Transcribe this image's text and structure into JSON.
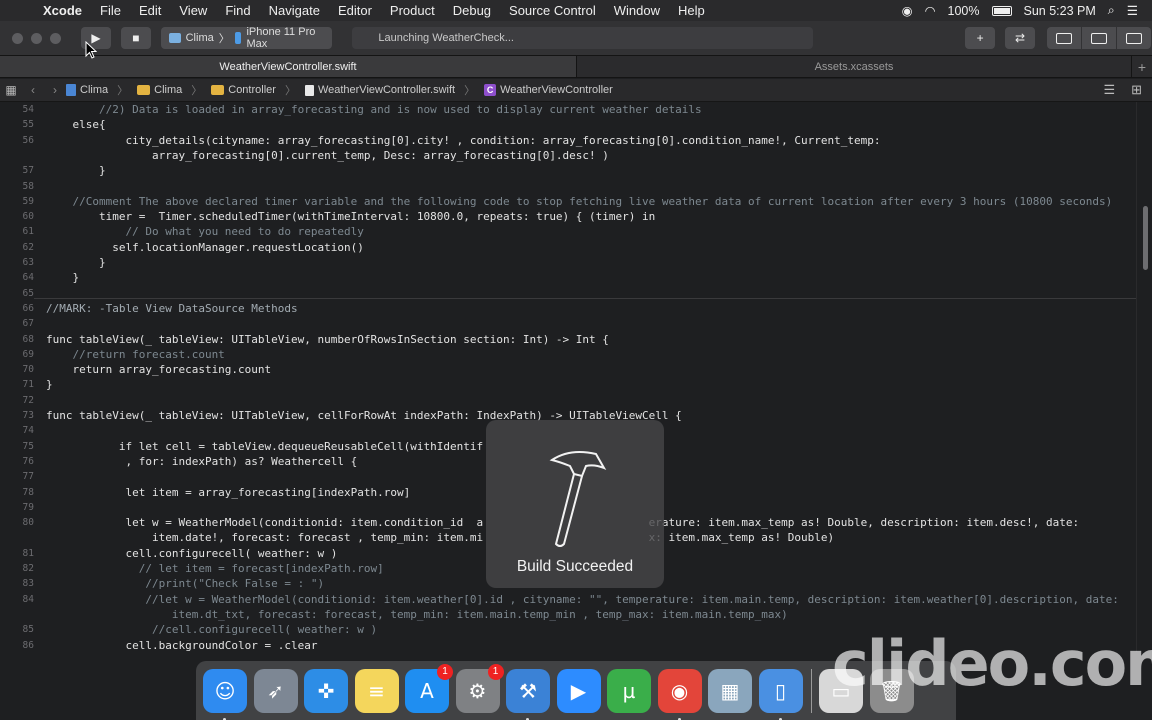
{
  "menubar": {
    "app": "Xcode",
    "items": [
      "File",
      "Edit",
      "View",
      "Find",
      "Navigate",
      "Editor",
      "Product",
      "Debug",
      "Source Control",
      "Window",
      "Help"
    ],
    "battery": "100%",
    "clock": "Sun 5:23 PM"
  },
  "toolbar": {
    "scheme_project": "Clima",
    "scheme_device": "iPhone 11 Pro Max",
    "activity": "Launching WeatherCheck..."
  },
  "tabs": [
    "WeatherViewController.swift",
    "Assets.xcassets"
  ],
  "jumpbar": {
    "crumbs": [
      "Clima",
      "Clima",
      "Controller",
      "WeatherViewController.swift",
      "WeatherViewController"
    ]
  },
  "code_lines": [
    {
      "n": "54",
      "text": "        //2) Data is loaded in array_forecasting and is now used to display current weather details",
      "kind": "comment"
    },
    {
      "n": "55",
      "text": "    else{",
      "kind": "plain"
    },
    {
      "n": "56",
      "text": "            city_details(cityname: array_forecasting[0].city! , condition: array_forecasting[0].condition_name!, Current_temp:",
      "kind": "plain"
    },
    {
      "n": "",
      "text": "                array_forecasting[0].current_temp, Desc: array_forecasting[0].desc! )",
      "kind": "plain"
    },
    {
      "n": "57",
      "text": "        }",
      "kind": "plain"
    },
    {
      "n": "58",
      "text": "",
      "kind": "plain"
    },
    {
      "n": "59",
      "text": "    //Comment The above declared timer variable and the following code to stop fetching live weather data of current location after every 3 hours (10800 seconds)",
      "kind": "comment"
    },
    {
      "n": "60",
      "text": "        timer =  Timer.scheduledTimer(withTimeInterval: 10800.0, repeats: true) { (timer) in",
      "kind": "plain"
    },
    {
      "n": "61",
      "text": "            // Do what you need to do repeatedly",
      "kind": "comment"
    },
    {
      "n": "62",
      "text": "          self.locationManager.requestLocation()",
      "kind": "plain"
    },
    {
      "n": "63",
      "text": "        }",
      "kind": "plain"
    },
    {
      "n": "64",
      "text": "    }",
      "kind": "plain"
    },
    {
      "n": "65",
      "text": "",
      "kind": "plain"
    },
    {
      "n": "66",
      "text": "//MARK: -Table View DataSource Methods",
      "kind": "mark"
    },
    {
      "n": "67",
      "text": "",
      "kind": "plain"
    },
    {
      "n": "68",
      "text": "func tableView(_ tableView: UITableView, numberOfRowsInSection section: Int) -> Int {",
      "kind": "plain"
    },
    {
      "n": "69",
      "text": "    //return forecast.count",
      "kind": "comment"
    },
    {
      "n": "70",
      "text": "    return array_forecasting.count",
      "kind": "plain"
    },
    {
      "n": "71",
      "text": "}",
      "kind": "plain"
    },
    {
      "n": "72",
      "text": "",
      "kind": "plain"
    },
    {
      "n": "73",
      "text": "func tableView(_ tableView: UITableView, cellForRowAt indexPath: IndexPath) -> UITableViewCell {",
      "kind": "plain"
    },
    {
      "n": "74",
      "text": "",
      "kind": "plain"
    },
    {
      "n": "75",
      "text": "           if let cell = tableView.dequeueReusableCell(withIdentif",
      "kind": "plain"
    },
    {
      "n": "76",
      "text": "            , for: indexPath) as? Weathercell {",
      "kind": "plain"
    },
    {
      "n": "77",
      "text": "",
      "kind": "plain"
    },
    {
      "n": "78",
      "text": "            let item = array_forecasting[indexPath.row]",
      "kind": "plain"
    },
    {
      "n": "79",
      "text": "",
      "kind": "plain"
    },
    {
      "n": "80",
      "text": "            let w = WeatherModel(conditionid: item.condition_id  a                         erature: item.max_temp as! Double, description: item.desc!, date:",
      "kind": "plain"
    },
    {
      "n": "",
      "text": "                item.date!, forecast: forecast , temp_min: item.mi                         x: item.max_temp as! Double)",
      "kind": "plain"
    },
    {
      "n": "81",
      "text": "            cell.configurecell( weather: w )",
      "kind": "plain"
    },
    {
      "n": "82",
      "text": "              // let item = forecast[indexPath.row]",
      "kind": "comment"
    },
    {
      "n": "83",
      "text": "               //print(\"Check False = : \")",
      "kind": "comment"
    },
    {
      "n": "84",
      "text": "               //let w = WeatherModel(conditionid: item.weather[0].id , cityname: \"\", temperature: item.main.temp, description: item.weather[0].description, date:",
      "kind": "comment"
    },
    {
      "n": "",
      "text": "                   item.dt_txt, forecast: forecast, temp_min: item.main.temp_min , temp_max: item.main.temp_max)",
      "kind": "comment"
    },
    {
      "n": "85",
      "text": "                //cell.configurecell( weather: w )",
      "kind": "comment"
    },
    {
      "n": "86",
      "text": "            cell.backgroundColor = .clear",
      "kind": "plain"
    }
  ],
  "hud": {
    "label": "Build Succeeded",
    "icon": "hammer-icon"
  },
  "dock": {
    "items": [
      {
        "name": "finder-icon",
        "glyph": "☺",
        "color": "#2f8bf0",
        "badge": ""
      },
      {
        "name": "launchpad-icon",
        "glyph": "➶",
        "color": "#7d8794",
        "badge": ""
      },
      {
        "name": "safari-icon",
        "glyph": "✜",
        "color": "#2d8de6",
        "badge": ""
      },
      {
        "name": "notes-icon",
        "glyph": "≡",
        "color": "#f4d65c",
        "badge": ""
      },
      {
        "name": "app-store-icon",
        "glyph": "A",
        "color": "#1f8ef1",
        "badge": "1"
      },
      {
        "name": "system-preferences-icon",
        "glyph": "⚙",
        "color": "#7f8184",
        "badge": "1"
      },
      {
        "name": "xcode-icon",
        "glyph": "⚒",
        "color": "#3b82d6",
        "badge": ""
      },
      {
        "name": "zoom-icon",
        "glyph": "▶",
        "color": "#2d8cff",
        "badge": ""
      },
      {
        "name": "utorrent-icon",
        "glyph": "µ",
        "color": "#3aae4a",
        "badge": ""
      },
      {
        "name": "chrome-icon",
        "glyph": "◉",
        "color": "#e3453a",
        "badge": ""
      },
      {
        "name": "preview-icon",
        "glyph": "▦",
        "color": "#8aa6bd",
        "badge": ""
      },
      {
        "name": "simulator-icon",
        "glyph": "▯",
        "color": "#4a90e2",
        "badge": ""
      },
      {
        "name": "chrome-apps-icon",
        "glyph": "▭",
        "color": "#d8d8d8",
        "badge": ""
      },
      {
        "name": "trash-icon",
        "glyph": "🗑",
        "color": "#8c8c8c",
        "badge": ""
      }
    ]
  },
  "watermark": "clideo.com"
}
